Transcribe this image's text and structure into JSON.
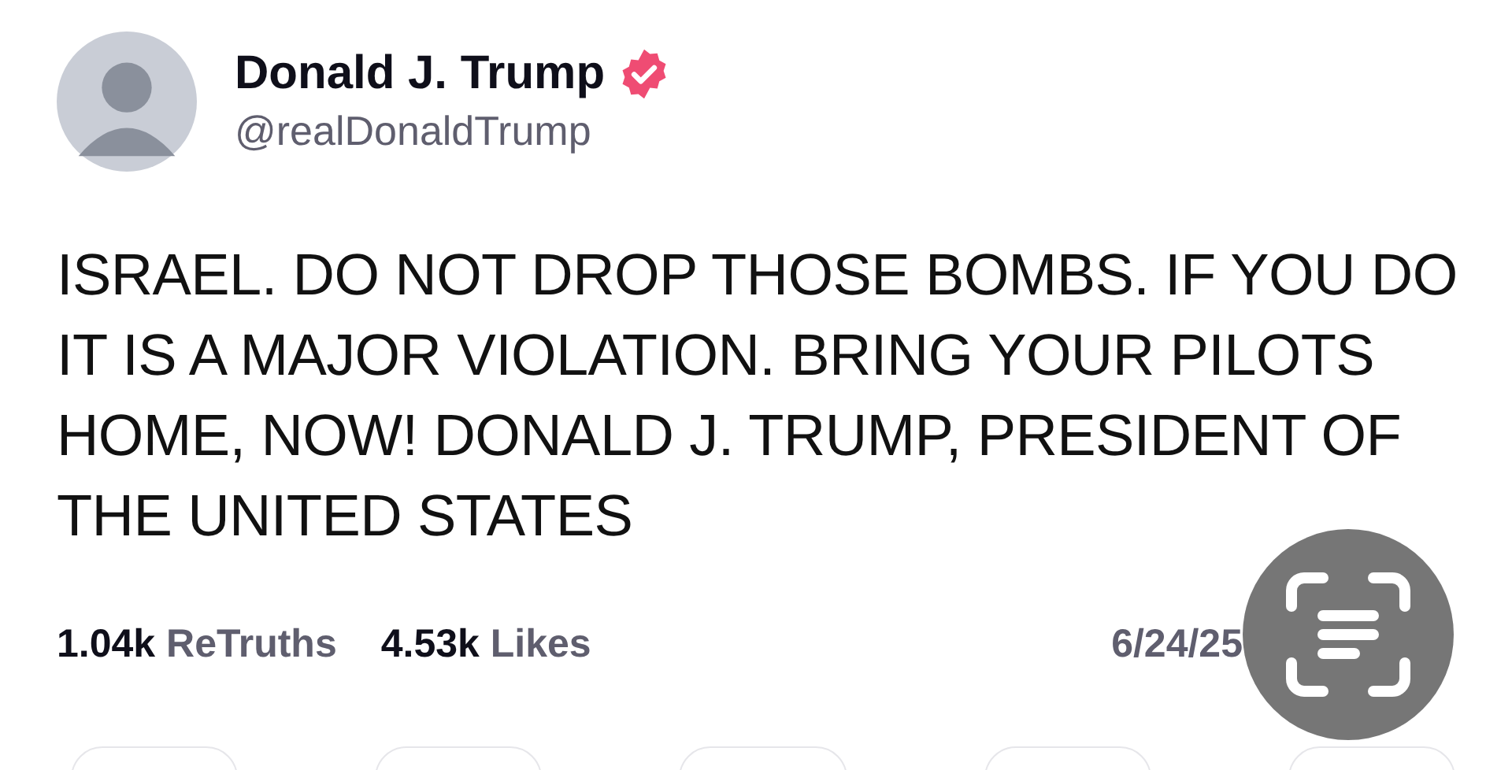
{
  "author": {
    "name": "Donald J. Trump",
    "verified": true,
    "handle": "@realDonaldTrump"
  },
  "post": {
    "text": "ISRAEL. DO NOT DROP THOSE BOMBS. IF YOU DO IT IS A MAJOR VIOLATION. BRING YOUR PILOTS HOME, NOW! DONALD J. TRUMP, PRESIDENT OF THE UNITED STATES"
  },
  "stats": [
    {
      "count": "1.04k",
      "label": "ReTruths"
    },
    {
      "count": "4.53k",
      "label": "Likes"
    }
  ],
  "date": "6/24/25"
}
